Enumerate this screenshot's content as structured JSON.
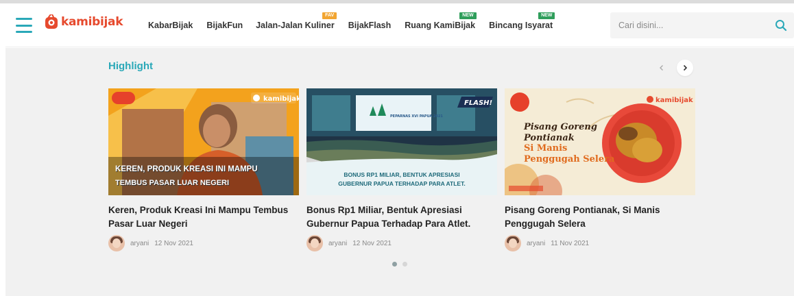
{
  "header": {
    "logo_text": "kamibijak",
    "menu_icon": "hamburger-icon",
    "nav": [
      {
        "label": "KabarBijak",
        "badge": ""
      },
      {
        "label": "BijakFun",
        "badge": ""
      },
      {
        "label": "Jalan-Jalan Kuliner",
        "badge": "FAV"
      },
      {
        "label": "BijakFlash",
        "badge": ""
      },
      {
        "label": "Ruang KamiBijak",
        "badge": "NEW"
      },
      {
        "label": "Bincang Isyarat",
        "badge": "NEW"
      }
    ],
    "search": {
      "placeholder": "Cari disini...",
      "value": "",
      "icon": "search-icon"
    }
  },
  "highlight": {
    "title": "Highlight",
    "prev_icon": "chevron-left-icon",
    "next_icon": "chevron-right-icon",
    "cards": [
      {
        "title": "Keren, Produk Kreasi Ini Mampu Tembus Pasar Luar Negeri",
        "overlay_line1": "KEREN, PRODUK KREASI INI MAMPU",
        "overlay_line2": "TEMBUS PASAR LUAR NEGERI",
        "author": "aryani",
        "date": "12 Nov 2021"
      },
      {
        "title": "Bonus Rp1 Miliar, Bentuk Apresiasi Gubernur Papua Terhadap Para Atlet.",
        "overlay_line1": "BONUS RP1 MILIAR, BENTUK APRESIASI",
        "overlay_line2": "GUBERNUR PAPUA TERHADAP PARA ATLET.",
        "overlay_tag": "FLASH!",
        "screen_text": "PEPARNAS XVI PAPUA 2021",
        "author": "aryani",
        "date": "12 Nov 2021"
      },
      {
        "title": "Pisang Goreng Pontianak, Si Manis Penggugah Selera",
        "overlay_line1": "Pisang Goreng",
        "overlay_line2": "Pontianak",
        "overlay_line3": "Si Manis",
        "overlay_line4": "Penggugah Selera",
        "author": "aryani",
        "date": "11 Nov 2021"
      }
    ],
    "pagination": {
      "total": 2,
      "active_index": 1
    }
  },
  "colors": {
    "accent": "#2aa8b8",
    "brand": "#e64a2e",
    "badge_fav": "#f2a531",
    "badge_new": "#2f9e5b",
    "page_bg": "#f1f1f1"
  }
}
